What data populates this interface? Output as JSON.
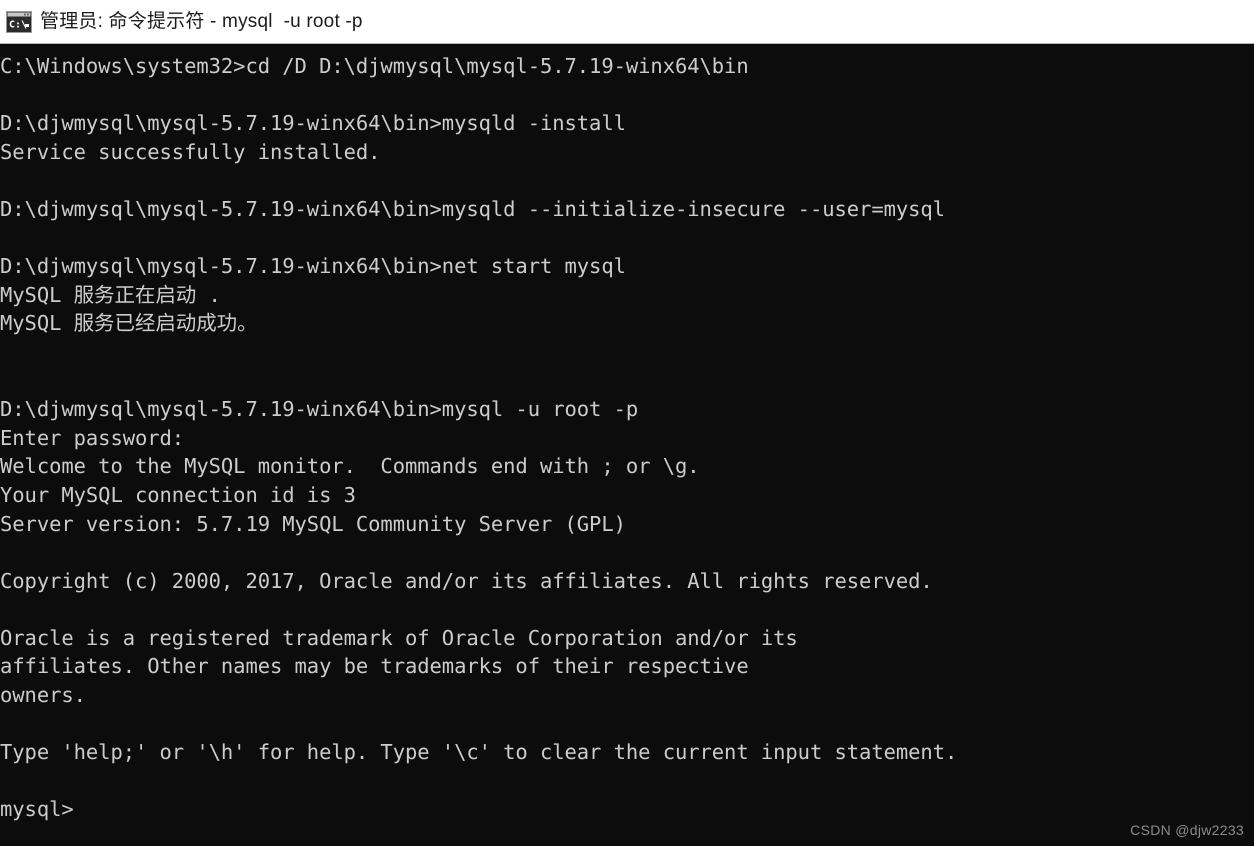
{
  "window": {
    "title": "管理员: 命令提示符 - mysql  -u root -p",
    "icon": "cmd-console-icon",
    "titlebar_bg": "#ffffff",
    "titlebar_fg": "#1c1c1c",
    "console_bg": "#0c0c0c",
    "console_fg": "#cccccc"
  },
  "console": {
    "lines": [
      "C:\\Windows\\system32>cd /D D:\\djwmysql\\mysql-5.7.19-winx64\\bin",
      "",
      "D:\\djwmysql\\mysql-5.7.19-winx64\\bin>mysqld -install",
      "Service successfully installed.",
      "",
      "D:\\djwmysql\\mysql-5.7.19-winx64\\bin>mysqld --initialize-insecure --user=mysql",
      "",
      "D:\\djwmysql\\mysql-5.7.19-winx64\\bin>net start mysql",
      "MySQL 服务正在启动 .",
      "MySQL 服务已经启动成功。",
      "",
      "",
      "D:\\djwmysql\\mysql-5.7.19-winx64\\bin>mysql -u root -p",
      "Enter password:",
      "Welcome to the MySQL monitor.  Commands end with ; or \\g.",
      "Your MySQL connection id is 3",
      "Server version: 5.7.19 MySQL Community Server (GPL)",
      "",
      "Copyright (c) 2000, 2017, Oracle and/or its affiliates. All rights reserved.",
      "",
      "Oracle is a registered trademark of Oracle Corporation and/or its",
      "affiliates. Other names may be trademarks of their respective",
      "owners.",
      "",
      "Type 'help;' or '\\h' for help. Type '\\c' to clear the current input statement.",
      "",
      "mysql>"
    ],
    "prompt": "mysql>"
  },
  "watermark": {
    "text": "CSDN @djw2233"
  }
}
